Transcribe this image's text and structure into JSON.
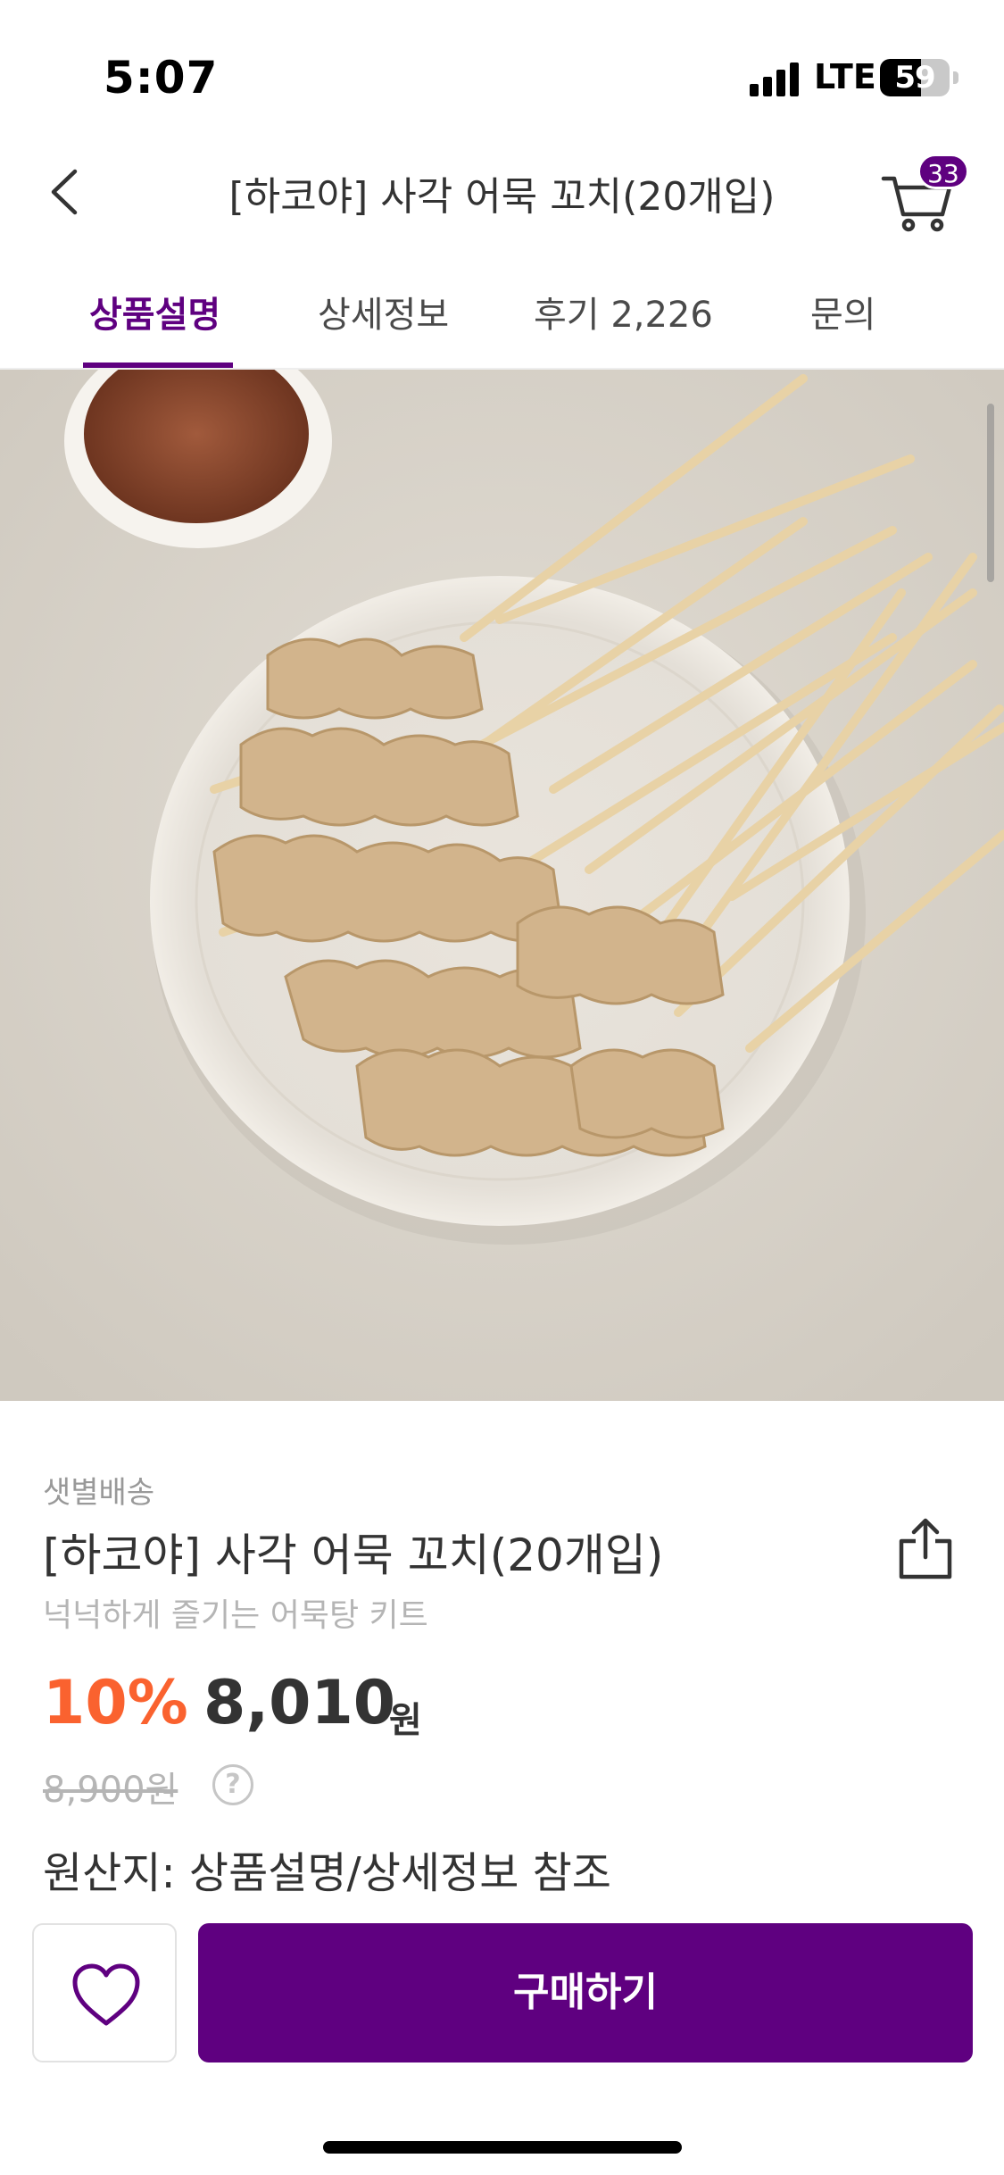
{
  "status_bar": {
    "time": "5:07",
    "network": "LTE",
    "battery": "59",
    "battery_level_percent": 59
  },
  "header": {
    "title": "[하코야] 사각 어묵 꼬치(20개입)",
    "cart_count": "33"
  },
  "tabs": [
    {
      "label": "상품설명",
      "active": true
    },
    {
      "label": "상세정보",
      "active": false
    },
    {
      "label": "후기 2,226",
      "active": false
    },
    {
      "label": "문의",
      "active": false
    }
  ],
  "product": {
    "delivery_type": "샛별배송",
    "name": "[하코야] 사각 어묵 꼬치(20개입)",
    "subtitle": "넉넉하게 즐기는 어묵탕 키트",
    "discount": "10%",
    "price": "8,010",
    "currency": "원",
    "original_price": "8,900원",
    "help_glyph": "?",
    "origin": "원산지: 상품설명/상세정보 참조"
  },
  "actions": {
    "buy_label": "구매하기",
    "wish_icon": "heart-outline-icon"
  },
  "colors": {
    "brand_purple": "#5f0080",
    "discount_orange": "#fa622f"
  }
}
